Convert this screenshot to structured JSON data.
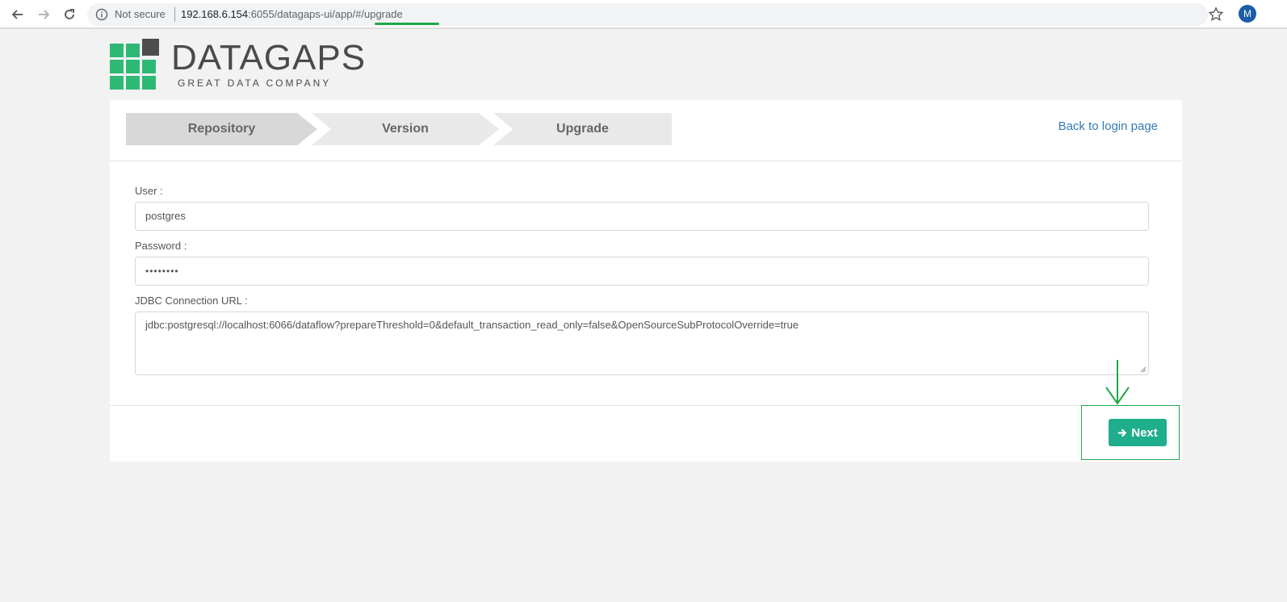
{
  "browser": {
    "security_label": "Not secure",
    "url_host": "192.168.6.154",
    "url_rest": ":6055/datagaps-ui/app/#/upgrade",
    "avatar_letter": "M"
  },
  "logo": {
    "name": "DATAGAPS",
    "tagline": "GREAT  DATA COMPANY"
  },
  "wizard": {
    "steps": [
      {
        "label": "Repository",
        "active": true
      },
      {
        "label": "Version",
        "active": false
      },
      {
        "label": "Upgrade",
        "active": false
      }
    ],
    "back_link": "Back to login page"
  },
  "form": {
    "user_label": "User :",
    "user_value": "postgres",
    "password_label": "Password :",
    "password_value": "••••••••",
    "jdbc_label": "JDBC Connection URL :",
    "jdbc_value": "jdbc:postgresql://localhost:6066/dataflow?prepareThreshold=0&default_transaction_read_only=false&OpenSourceSubProtocolOverride=true"
  },
  "footer": {
    "next_label": "Next"
  },
  "colors": {
    "brand_green": "#2db975",
    "button_teal": "#1fae8c",
    "link_blue": "#337ab7",
    "annotation_green": "#1fa84a"
  }
}
